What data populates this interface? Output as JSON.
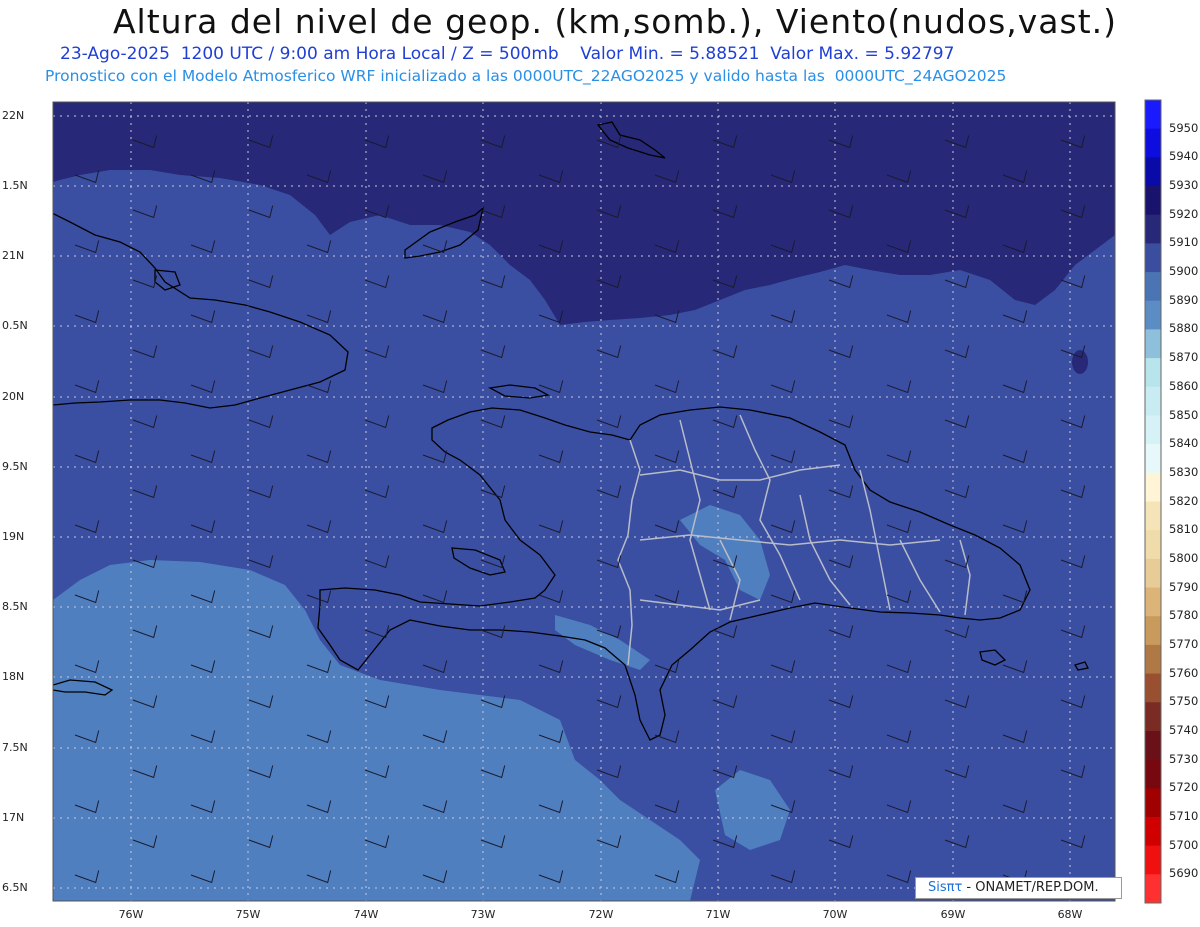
{
  "title": "Altura del nivel de geop. (km,somb.), Viento(nudos,vast.)",
  "subtitle_line1": "23-Ago-2025  1200 UTC / 9:00 am Hora Local / Z = 500mb    Valor Min. = 5.88521  Valor Max. = 5.92797",
  "subtitle_line2": "Pronostico con el Modelo Atmosferico WRF inicializado a las 0000UTC_22AGO2025 y valido hasta las  0000UTC_24AGO2025",
  "lat_labels": [
    "22N",
    "1.5N",
    "21N",
    "0.5N",
    "20N",
    "9.5N",
    "19N",
    "8.5N",
    "18N",
    "7.5N",
    "17N",
    "6.5N"
  ],
  "lon_labels": [
    "76W",
    "75W",
    "74W",
    "73W",
    "72W",
    "71W",
    "70W",
    "69W",
    "68W"
  ],
  "colorbar": {
    "labels": [
      "5950",
      "5940",
      "5930",
      "5920",
      "5910",
      "5900",
      "5890",
      "5880",
      "5870",
      "5860",
      "5850",
      "5840",
      "5830",
      "5820",
      "5810",
      "5800",
      "5790",
      "5780",
      "5770",
      "5760",
      "5750",
      "5740",
      "5730",
      "5720",
      "5710",
      "5700",
      "5690"
    ],
    "colors": [
      "#1a1aff",
      "#0d0de0",
      "#0a0aa8",
      "#1a136e",
      "#272878",
      "#3a4d9e",
      "#4a74b4",
      "#5b8dc4",
      "#8ec0dc",
      "#b8e4ec",
      "#c8ecf2",
      "#d6f2f6",
      "#e6f8fa",
      "#fff5d6",
      "#f4e4b8",
      "#f0dcaa",
      "#e8cc98",
      "#dcb478",
      "#c89a5c",
      "#b07844",
      "#985030",
      "#7a2c24",
      "#6a1018",
      "#780810",
      "#a00000",
      "#d00000",
      "#f01010",
      "#ff3030"
    ]
  },
  "credit": {
    "brand": "Sisπτ",
    "text": " - ONAMET/REP.DOM."
  },
  "colors": {
    "deep": "#272878",
    "mid": "#3b4fa2",
    "light": "#4f7fbf",
    "lighter": "#5d8cc6"
  }
}
